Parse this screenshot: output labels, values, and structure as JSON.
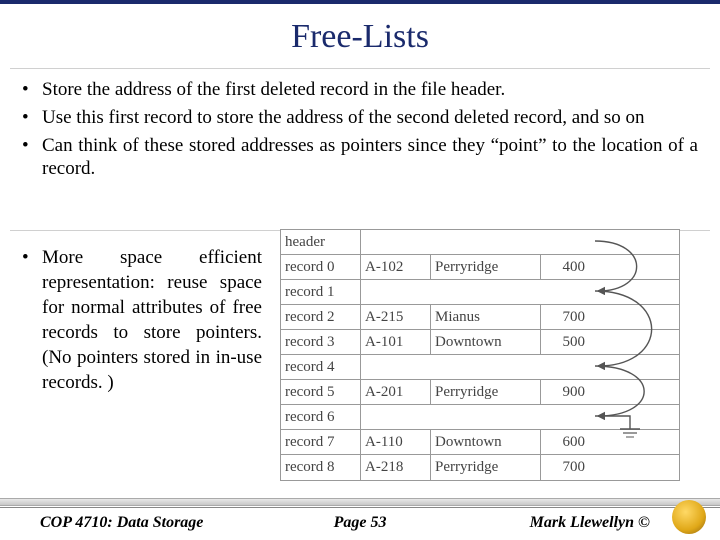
{
  "title": "Free-Lists",
  "bullets_top": [
    "Store the address of the first deleted record in the file header.",
    "Use this first record to store the address of the second deleted record, and so on",
    "Can think of these stored addresses as pointers since they “point” to the location of a record."
  ],
  "bullet_lower": "More space efficient representation: reuse space for normal attributes of free records to store pointers. (No pointers stored in in-use records. )",
  "table": {
    "rows": [
      {
        "label": "header",
        "a": "",
        "b": "",
        "c": "",
        "free": true
      },
      {
        "label": "record 0",
        "a": "A-102",
        "b": "Perryridge",
        "c": "400",
        "free": false
      },
      {
        "label": "record 1",
        "a": "",
        "b": "",
        "c": "",
        "free": true
      },
      {
        "label": "record 2",
        "a": "A-215",
        "b": "Mianus",
        "c": "700",
        "free": false
      },
      {
        "label": "record 3",
        "a": "A-101",
        "b": "Downtown",
        "c": "500",
        "free": false
      },
      {
        "label": "record 4",
        "a": "",
        "b": "",
        "c": "",
        "free": true
      },
      {
        "label": "record 5",
        "a": "A-201",
        "b": "Perryridge",
        "c": "900",
        "free": false
      },
      {
        "label": "record 6",
        "a": "",
        "b": "",
        "c": "",
        "free": true
      },
      {
        "label": "record 7",
        "a": "A-110",
        "b": "Downtown",
        "c": "600",
        "free": false
      },
      {
        "label": "record 8",
        "a": "A-218",
        "b": "Perryridge",
        "c": "700",
        "free": false
      }
    ]
  },
  "footer": {
    "left": "COP 4710: Data Storage",
    "center": "Page 53",
    "right": "Mark Llewellyn ©"
  }
}
